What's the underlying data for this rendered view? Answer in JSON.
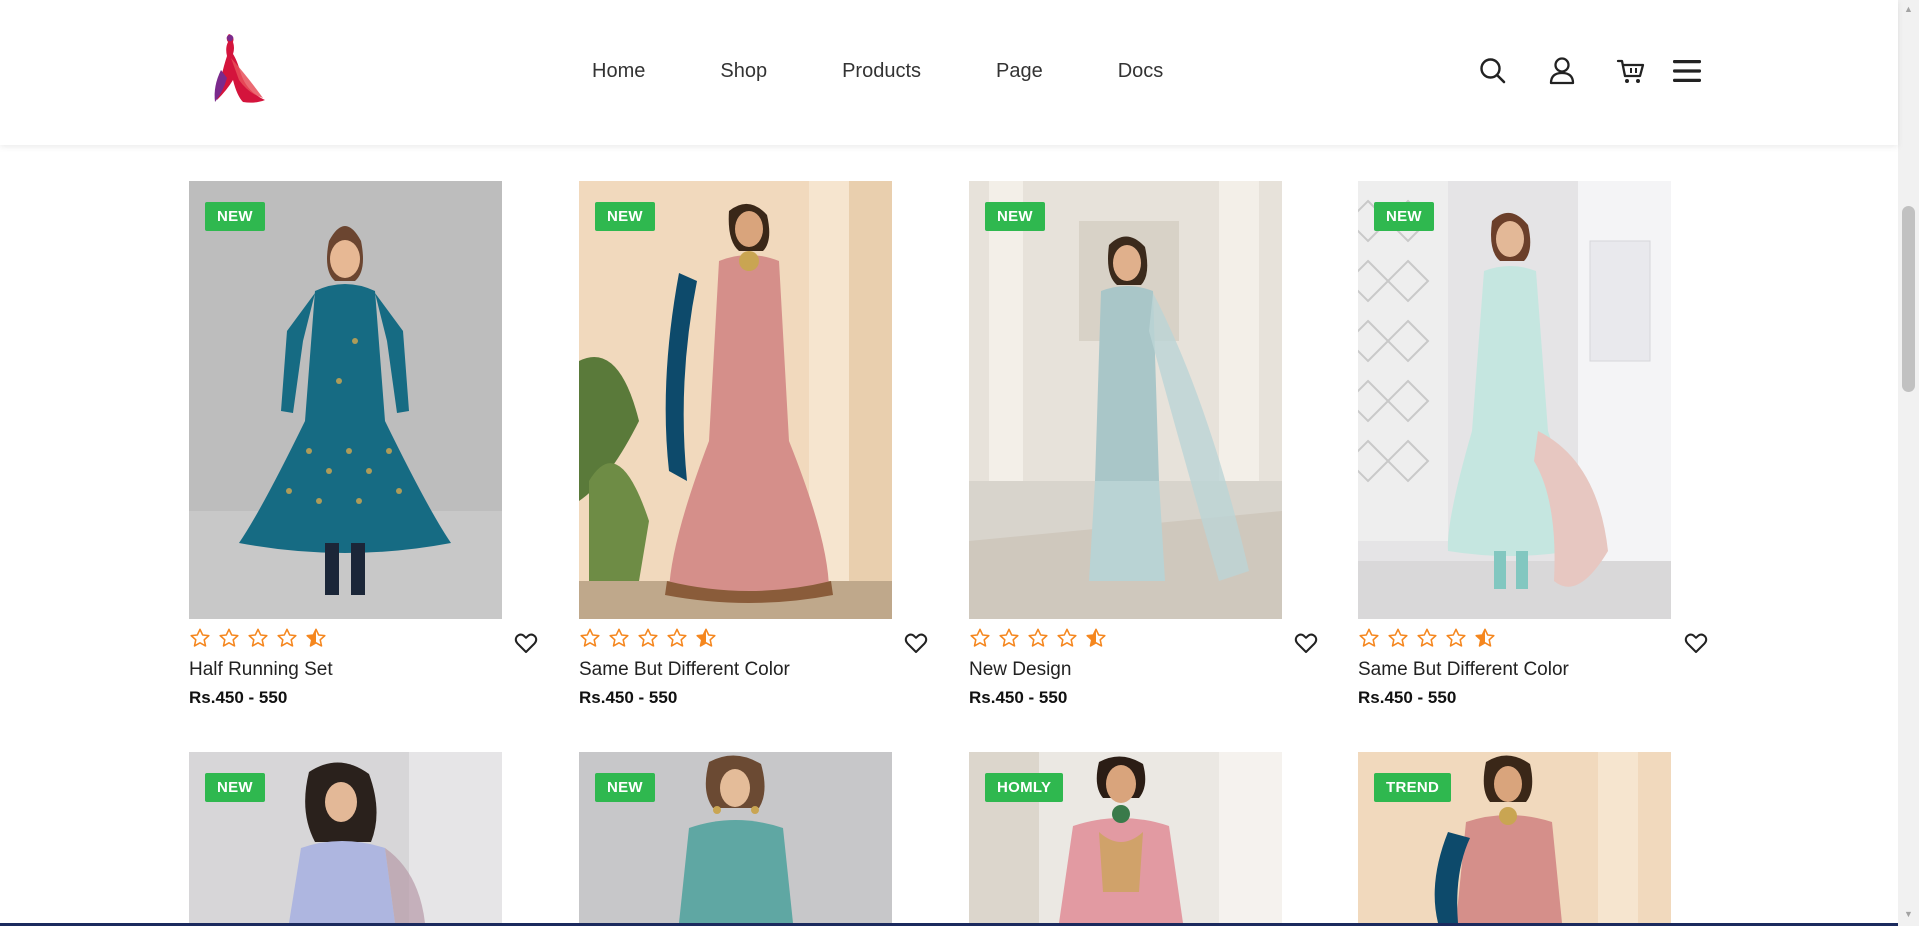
{
  "nav": {
    "home": "Home",
    "shop": "Shop",
    "products": "Products",
    "page": "Page",
    "docs": "Docs"
  },
  "icons": {
    "search": "search-icon",
    "account": "user-icon",
    "cart": "cart-icon",
    "menu": "hamburger-menu-icon",
    "wishlist": "heart-icon",
    "rating_star": "star-icon"
  },
  "colors": {
    "badge": "#2fb84f",
    "star": "#f5871f",
    "logo_red": "#d4143c",
    "logo_purple": "#7b2a8c"
  },
  "products": [
    {
      "badge": "NEW",
      "name": "Half Running Set",
      "price": "Rs.450 - 550",
      "rating": 4.5
    },
    {
      "badge": "NEW",
      "name": "Same But Different Color",
      "price": "Rs.450 - 550",
      "rating": 4.5
    },
    {
      "badge": "NEW",
      "name": "New Design",
      "price": "Rs.450 - 550",
      "rating": 4.5
    },
    {
      "badge": "NEW",
      "name": "Same But Different Color",
      "price": "Rs.450 - 550",
      "rating": 4.5
    },
    {
      "badge": "NEW"
    },
    {
      "badge": "NEW"
    },
    {
      "badge": "HOMLY"
    },
    {
      "badge": "TREND"
    }
  ]
}
